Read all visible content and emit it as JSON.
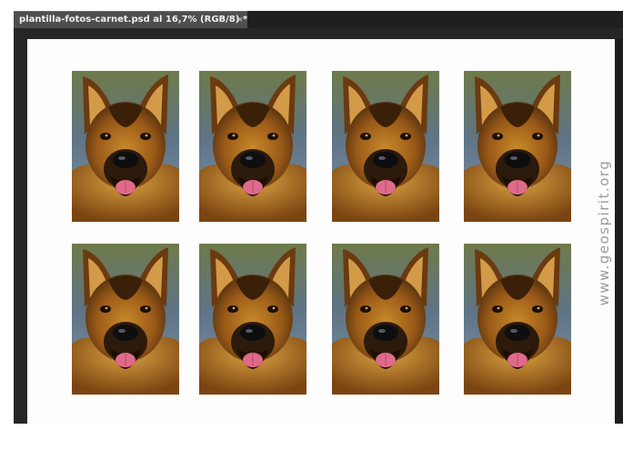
{
  "document_tab": {
    "title": "plantilla-fotos-carnet.psd al 16,7% (RGB/8) *",
    "close_icon": "close-icon",
    "close_glyph": "×"
  },
  "canvas": {
    "background_color": "#262626",
    "document_color": "#fdfdfd",
    "photo_subject": "german-shepherd-dog-portrait",
    "photo_count": 8,
    "rows": 2,
    "columns": 4
  },
  "watermark": {
    "text": "www.geospirit.org"
  }
}
